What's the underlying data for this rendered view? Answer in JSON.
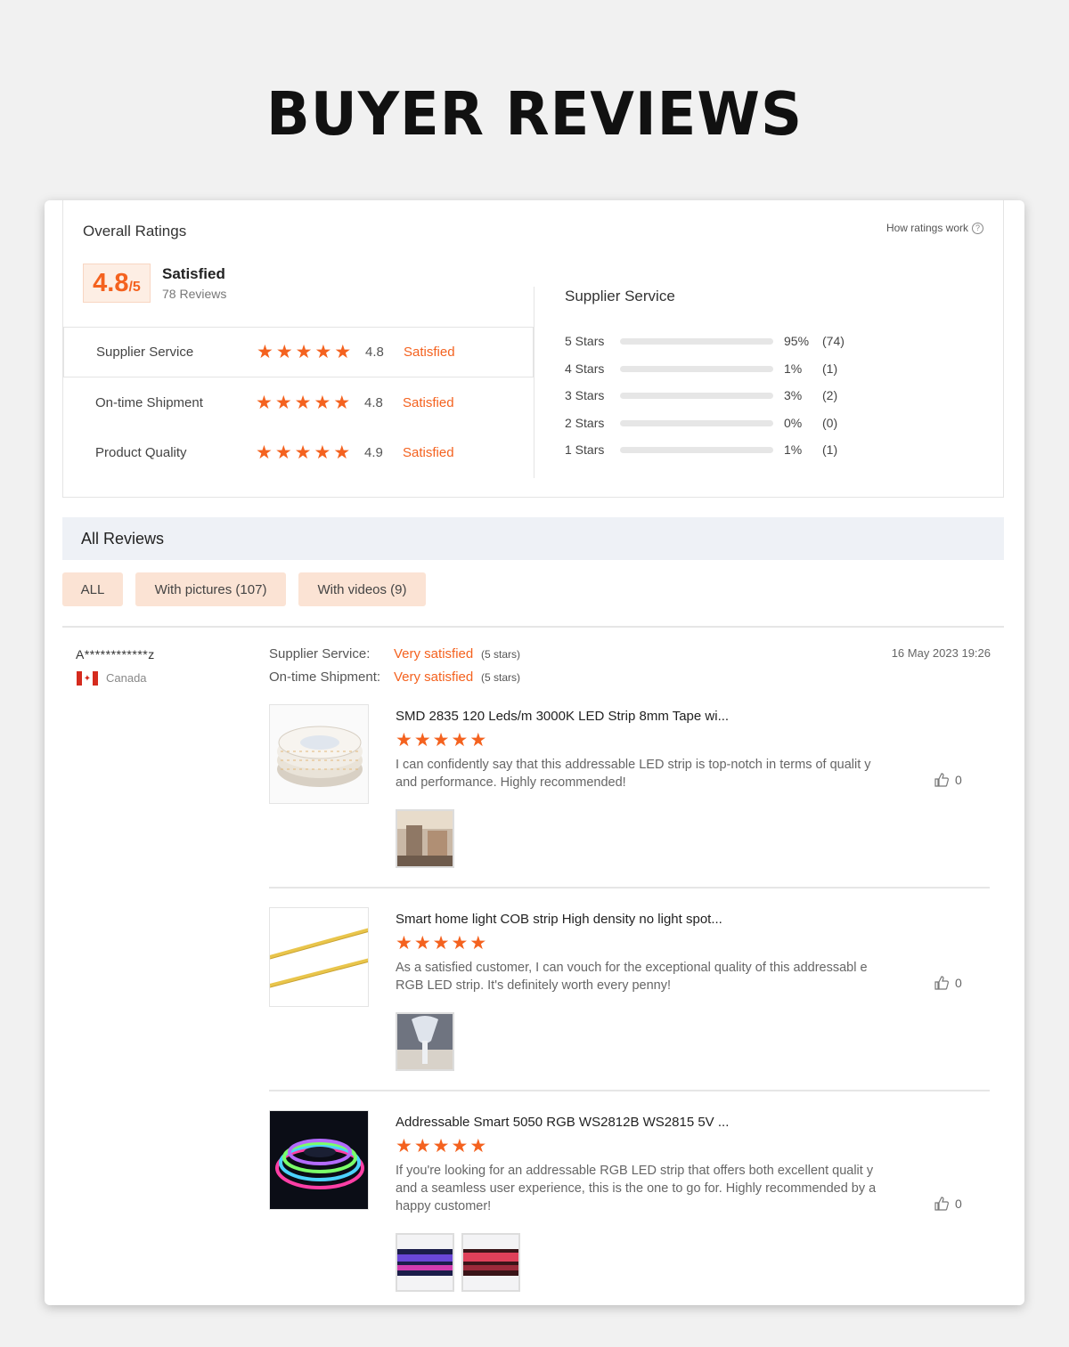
{
  "page": {
    "title": "BUYER REVIEWS"
  },
  "overall": {
    "heading": "Overall Ratings",
    "how_link": "How ratings work",
    "score": "4.8",
    "score_out_of": "/5",
    "summary_word": "Satisfied",
    "review_count": "78 Reviews",
    "categories": [
      {
        "label": "Supplier Service",
        "stars": 5,
        "score": "4.8",
        "word": "Satisfied"
      },
      {
        "label": "On-time Shipment",
        "stars": 5,
        "score": "4.8",
        "word": "Satisfied"
      },
      {
        "label": "Product Quality",
        "stars": 5,
        "score": "4.9",
        "word": "Satisfied"
      }
    ]
  },
  "distribution": {
    "heading": "Supplier Service",
    "rows": [
      {
        "label": "5 Stars",
        "fraction": 0.95,
        "pct": "95%",
        "count": "(74)"
      },
      {
        "label": "4 Stars",
        "fraction": 0.01,
        "pct": "1%",
        "count": "(1)"
      },
      {
        "label": "3 Stars",
        "fraction": 0.03,
        "pct": "3%",
        "count": "(2)"
      },
      {
        "label": "2 Stars",
        "fraction": 0.0,
        "pct": "0%",
        "count": "(0)"
      },
      {
        "label": "1 Stars",
        "fraction": 0.01,
        "pct": "1%",
        "count": "(1)"
      }
    ]
  },
  "reviews_section": {
    "heading": "All Reviews",
    "filters": [
      "ALL",
      "With pictures (107)",
      "With videos (9)"
    ]
  },
  "review": {
    "reviewer": "A************z",
    "country": "Canada",
    "date": "16 May 2023 19:26",
    "meta": [
      {
        "label": "Supplier Service:",
        "value": "Very satisfied",
        "stars": "(5 stars)"
      },
      {
        "label": "On-time Shipment:",
        "value": "Very satisfied",
        "stars": "(5 stars)"
      }
    ],
    "items": [
      {
        "title": "SMD 2835 120 Leds/m 3000K LED Strip 8mm Tape wi...",
        "stars": 5,
        "text": "I can confidently say that this addressable LED strip is top-notch in terms of qualit y and performance. Highly recommended!",
        "likes": "0"
      },
      {
        "title": "Smart home light COB strip High density no light spot...",
        "stars": 5,
        "text": "As a satisfied customer, I can vouch for the exceptional quality of this addressabl e RGB LED strip. It's definitely worth every penny!",
        "likes": "0"
      },
      {
        "title": "Addressable Smart 5050 RGB WS2812B WS2815 5V ...",
        "stars": 5,
        "text": "If you're looking for an addressable RGB LED strip that offers both excellent qualit y and a seamless user experience, this is the one to go for. Highly recommended by a happy customer!",
        "likes": "0"
      }
    ]
  },
  "colors": {
    "accent": "#f4621f",
    "badge_bg": "#fdeee4",
    "filter_bg": "#fbe3d4",
    "header_bg": "#eef1f6"
  }
}
